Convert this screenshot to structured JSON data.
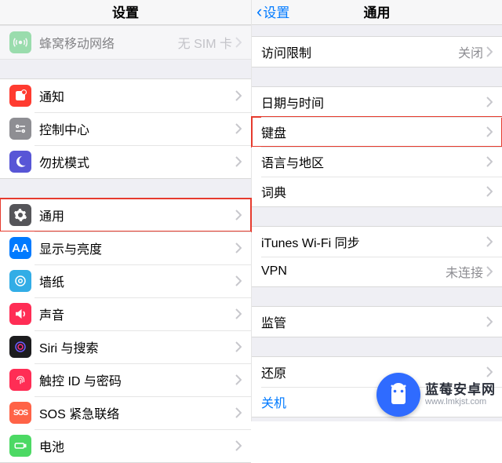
{
  "left": {
    "header": {
      "title": "设置"
    },
    "row_cellular": {
      "label": "蜂窝移动网络",
      "value": "无 SIM 卡"
    },
    "row_notifications": {
      "label": "通知"
    },
    "row_control_center": {
      "label": "控制中心"
    },
    "row_dnd": {
      "label": "勿扰模式"
    },
    "row_general": {
      "label": "通用"
    },
    "row_display": {
      "label": "显示与亮度"
    },
    "row_wallpaper": {
      "label": "墙纸"
    },
    "row_sound": {
      "label": "声音"
    },
    "row_siri": {
      "label": "Siri 与搜索"
    },
    "row_touchid": {
      "label": "触控 ID 与密码"
    },
    "row_sos": {
      "label": "SOS 紧急联络",
      "icon_text": "SOS"
    },
    "row_battery": {
      "label": "电池"
    }
  },
  "right": {
    "header": {
      "title": "通用",
      "back": "设置"
    },
    "row_restrictions": {
      "label": "访问限制",
      "value": "关闭"
    },
    "row_datetime": {
      "label": "日期与时间"
    },
    "row_keyboard": {
      "label": "键盘"
    },
    "row_language": {
      "label": "语言与地区"
    },
    "row_dictionary": {
      "label": "词典"
    },
    "row_itunes": {
      "label": "iTunes Wi-Fi 同步"
    },
    "row_vpn": {
      "label": "VPN",
      "value": "未连接"
    },
    "row_supervised": {
      "label": "监管"
    },
    "row_reset": {
      "label": "还原"
    },
    "row_shutdown": {
      "label": "关机"
    }
  },
  "watermark": {
    "title": "蓝莓安卓网",
    "url": "www.lmkjst.com"
  }
}
